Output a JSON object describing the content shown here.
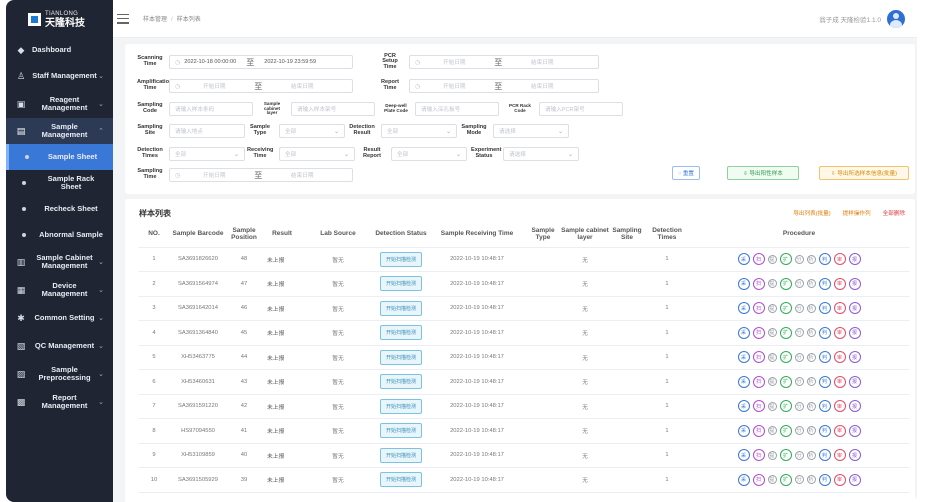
{
  "brand": {
    "en": "TIANLONG",
    "cn": "天隆科技"
  },
  "sidebar": {
    "items": [
      {
        "label": "Dashboard",
        "icon": "dashboard-icon",
        "glyph": "◆",
        "chevron": "",
        "kind": "top"
      },
      {
        "label": "Staff Management",
        "icon": "staff-icon",
        "glyph": "♙",
        "chevron": "⌄",
        "kind": "group"
      },
      {
        "label": "Reagent Management",
        "icon": "reagent-icon",
        "glyph": "▣",
        "chevron": "⌄",
        "kind": "group"
      },
      {
        "label": "Sample Management",
        "icon": "sample-icon",
        "glyph": "▤",
        "chevron": "⌃",
        "kind": "active"
      },
      {
        "label": "Sample Sheet",
        "icon": "",
        "glyph": "",
        "chevron": "",
        "kind": "sub-sel"
      },
      {
        "label": "Sample Rack Sheet",
        "icon": "",
        "glyph": "",
        "chevron": "",
        "kind": "sub"
      },
      {
        "label": "Recheck Sheet",
        "icon": "",
        "glyph": "",
        "chevron": "",
        "kind": "sub"
      },
      {
        "label": "Abnormal Sample",
        "icon": "",
        "glyph": "",
        "chevron": "",
        "kind": "sub"
      },
      {
        "label": "Sample Cabinet Management",
        "icon": "cabinet-icon",
        "glyph": "▥",
        "chevron": "⌄",
        "kind": "group"
      },
      {
        "label": "Device Management",
        "icon": "device-icon",
        "glyph": "▦",
        "chevron": "⌄",
        "kind": "group"
      },
      {
        "label": "Common Setting",
        "icon": "gear-icon",
        "glyph": "✱",
        "chevron": "⌄",
        "kind": "group"
      },
      {
        "label": "QC Management",
        "icon": "qc-icon",
        "glyph": "▧",
        "chevron": "⌄",
        "kind": "group"
      },
      {
        "label": "Sample Preprocessing",
        "icon": "preprocess-icon",
        "glyph": "▨",
        "chevron": "⌄",
        "kind": "group"
      },
      {
        "label": "Report Management",
        "icon": "report-icon",
        "glyph": "▩",
        "chevron": "⌄",
        "kind": "group"
      }
    ]
  },
  "header": {
    "breadcrumb": [
      "样本管理",
      "样本列表"
    ],
    "user": "翁子成 天隆检验1.1.0"
  },
  "filters": {
    "scanning_time": {
      "label": "Scanning Time",
      "start": "2022-10-18 00:00:00",
      "end": "2022-10-19 23:59:59"
    },
    "pcr_setup_time": {
      "label": "PCR Setup Time",
      "start": "开始日期",
      "end": "结束日期"
    },
    "amplification_time": {
      "label": "Amplification Time",
      "start": "开始日期",
      "end": "结束日期"
    },
    "report_time": {
      "label": "Report Time",
      "start": "开始日期",
      "end": "结束日期"
    },
    "sampling_code": {
      "label": "Sampling Code",
      "placeholder": "请输入样本条码"
    },
    "sample_cabinet_layer": {
      "label": "Sample cabinet layer",
      "placeholder": "请输入样本架号"
    },
    "deep_well_plate_code": {
      "label": "Deep-well Plate Code",
      "placeholder": "请输入深孔板号"
    },
    "pcr_rack_code": {
      "label": "PCR Rack Code",
      "placeholder": "请输入PCR架号"
    },
    "sampling_site": {
      "label": "Sampling Site",
      "placeholder": "请输入地点"
    },
    "sample_type": {
      "label": "Sample Type",
      "placeholder": "全部"
    },
    "detection_result": {
      "label": "Detection Result",
      "placeholder": "全部"
    },
    "sampling_mode": {
      "label": "Sampling Mode",
      "placeholder": "请选择"
    },
    "detection_times": {
      "label": "Detection Times",
      "placeholder": "全部"
    },
    "receiving_time": {
      "label": "Receiving Time",
      "placeholder": "全部"
    },
    "result_report": {
      "label": "Result Report",
      "placeholder": "全部"
    },
    "experiment_status": {
      "label": "Experiment Status",
      "placeholder": "请选择"
    },
    "sampling_time": {
      "label": "Sampling Time",
      "start": "开始日期",
      "end": "结束日期"
    },
    "arrow": "⌄",
    "to": "至",
    "cal": "◷",
    "reset_label": "◌ 重置",
    "export_green_label": "⇩ 导出阳性样本",
    "export_orange_label": "⇩ 导出所选样本信息(批量)"
  },
  "table": {
    "title": "样本列表",
    "links": [
      "导出列表(批量)",
      "提样操作列",
      "全部删除"
    ],
    "headers": [
      "NO.",
      "Sample Barcode",
      "Sample Position",
      "Result",
      "Lab Source",
      "Detection Status",
      "Sample Receiving Time",
      "Sample Type",
      "Sample cabinet layer",
      "Sampling Site",
      "Detection Times",
      "Procedure"
    ],
    "status_label": "开始扫描检测",
    "procedure": [
      {
        "t": "采",
        "c": "#3a78d8",
        "s": false
      },
      {
        "t": "扫",
        "c": "#b04bd1",
        "s": false
      },
      {
        "t": "提",
        "c": "#9aa0a8",
        "s": true
      },
      {
        "t": "扩",
        "c": "#2fae57",
        "s": false
      },
      {
        "t": "分",
        "c": "#9aa0a8",
        "s": true
      },
      {
        "t": "析",
        "c": "#9aa0a8",
        "s": true
      },
      {
        "t": "判",
        "c": "#3a78d8",
        "s": false
      },
      {
        "t": "审",
        "c": "#e04d6a",
        "s": false
      },
      {
        "t": "报",
        "c": "#8a5cd6",
        "s": false
      }
    ],
    "rows": [
      {
        "no": "1",
        "barcode": "SA3691826620",
        "pos": "48",
        "result": "未上报",
        "lab": "暂无",
        "time": "2022-10-19 10:48:17",
        "type": "",
        "layer": "无",
        "site": "",
        "times": "1"
      },
      {
        "no": "2",
        "barcode": "SA3691564974",
        "pos": "47",
        "result": "未上报",
        "lab": "暂无",
        "time": "2022-10-19 10:48:17",
        "type": "",
        "layer": "无",
        "site": "",
        "times": "1"
      },
      {
        "no": "3",
        "barcode": "SA3691642014",
        "pos": "46",
        "result": "未上报",
        "lab": "暂无",
        "time": "2022-10-19 10:48:17",
        "type": "",
        "layer": "无",
        "site": "",
        "times": "1"
      },
      {
        "no": "4",
        "barcode": "SA3691364840",
        "pos": "45",
        "result": "未上报",
        "lab": "暂无",
        "time": "2022-10-19 10:48:17",
        "type": "",
        "layer": "无",
        "site": "",
        "times": "1"
      },
      {
        "no": "5",
        "barcode": "XH53463775",
        "pos": "44",
        "result": "未上报",
        "lab": "暂无",
        "time": "2022-10-19 10:48:17",
        "type": "",
        "layer": "无",
        "site": "",
        "times": "1"
      },
      {
        "no": "6",
        "barcode": "XH53460631",
        "pos": "43",
        "result": "未上报",
        "lab": "暂无",
        "time": "2022-10-19 10:48:17",
        "type": "",
        "layer": "无",
        "site": "",
        "times": "1"
      },
      {
        "no": "7",
        "barcode": "SA3691591220",
        "pos": "42",
        "result": "未上报",
        "lab": "暂无",
        "time": "2022-10-19 10:48:17",
        "type": "",
        "layer": "无",
        "site": "",
        "times": "1"
      },
      {
        "no": "8",
        "barcode": "HS97094550",
        "pos": "41",
        "result": "未上报",
        "lab": "暂无",
        "time": "2022-10-19 10:48:17",
        "type": "",
        "layer": "无",
        "site": "",
        "times": "1"
      },
      {
        "no": "9",
        "barcode": "XH53109859",
        "pos": "40",
        "result": "未上报",
        "lab": "暂无",
        "time": "2022-10-19 10:48:17",
        "type": "",
        "layer": "无",
        "site": "",
        "times": "1"
      },
      {
        "no": "10",
        "barcode": "SA3691505929",
        "pos": "39",
        "result": "未上报",
        "lab": "暂无",
        "time": "2022-10-19 10:48:17",
        "type": "",
        "layer": "无",
        "site": "",
        "times": "1"
      }
    ]
  }
}
